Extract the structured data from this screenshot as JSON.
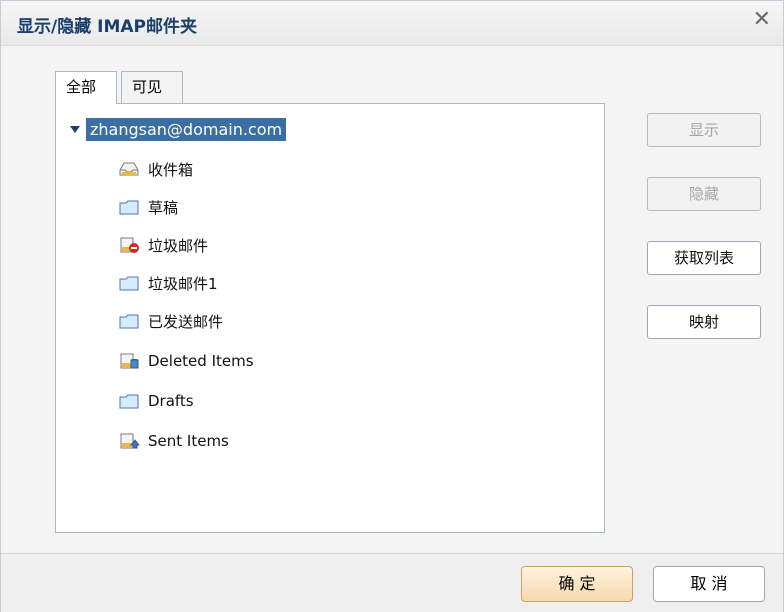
{
  "window": {
    "title": "显示/隐藏 IMAP邮件夹",
    "close_symbol": "✕"
  },
  "tabs": [
    {
      "label": "全部",
      "active": true
    },
    {
      "label": "可见",
      "active": false
    }
  ],
  "tree": {
    "root": "zhangsan@domain.com",
    "items": [
      {
        "label": "收件箱",
        "icon": "inbox-icon"
      },
      {
        "label": "草稿",
        "icon": "folder-icon"
      },
      {
        "label": "垃圾邮件",
        "icon": "junk-icon"
      },
      {
        "label": "垃圾邮件1",
        "icon": "folder-icon"
      },
      {
        "label": "已发送邮件",
        "icon": "folder-icon"
      },
      {
        "label": "Deleted Items",
        "icon": "trash-icon"
      },
      {
        "label": "Drafts",
        "icon": "folder-icon"
      },
      {
        "label": "Sent Items",
        "icon": "sent-icon"
      }
    ]
  },
  "side_buttons": {
    "show": {
      "label": "显示",
      "disabled": true
    },
    "hide": {
      "label": "隐藏",
      "disabled": true
    },
    "fetch": {
      "label": "获取列表",
      "disabled": false
    },
    "map": {
      "label": "映射",
      "disabled": false
    }
  },
  "footer": {
    "ok_label": "确 定",
    "cancel_label": "取 消"
  },
  "colors": {
    "accent": "#1b3f6b",
    "selection": "#3a6ea5",
    "ok_button": "#f6d9ad"
  }
}
